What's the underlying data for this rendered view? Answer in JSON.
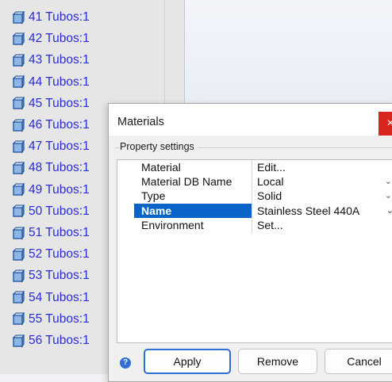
{
  "tree": {
    "items": [
      {
        "label": "41 Tubos:1"
      },
      {
        "label": "42 Tubos:1"
      },
      {
        "label": "43 Tubos:1"
      },
      {
        "label": "44 Tubos:1"
      },
      {
        "label": "45 Tubos:1"
      },
      {
        "label": "46 Tubos:1"
      },
      {
        "label": "47 Tubos:1"
      },
      {
        "label": "48 Tubos:1"
      },
      {
        "label": "49 Tubos:1"
      },
      {
        "label": "50 Tubos:1"
      },
      {
        "label": "51 Tubos:1"
      },
      {
        "label": "52 Tubos:1"
      },
      {
        "label": "53 Tubos:1"
      },
      {
        "label": "54 Tubos:1"
      },
      {
        "label": "55 Tubos:1"
      },
      {
        "label": "56 Tubos:1"
      }
    ],
    "icon": "part-cube-icon",
    "text_color": "#2b2bd6"
  },
  "dialog": {
    "title": "Materials",
    "close_glyph": "×",
    "group_label": "Property settings",
    "properties": [
      {
        "name": "Material",
        "value": "Edit...",
        "dropdown": false
      },
      {
        "name": "Material DB Name",
        "value": "Local",
        "dropdown": true
      },
      {
        "name": "Type",
        "value": "Solid",
        "dropdown": true
      },
      {
        "name": "Name",
        "value": "Stainless Steel 440A",
        "dropdown": true,
        "selected": true
      },
      {
        "name": "Environment",
        "value": "Set...",
        "dropdown": false
      }
    ],
    "help_glyph": "?",
    "buttons": {
      "apply": "Apply",
      "remove": "Remove",
      "cancel": "Cancel"
    }
  },
  "colors": {
    "selection": "#0a64c8",
    "close": "#d9261c",
    "primary_border": "#2b6fd6"
  }
}
